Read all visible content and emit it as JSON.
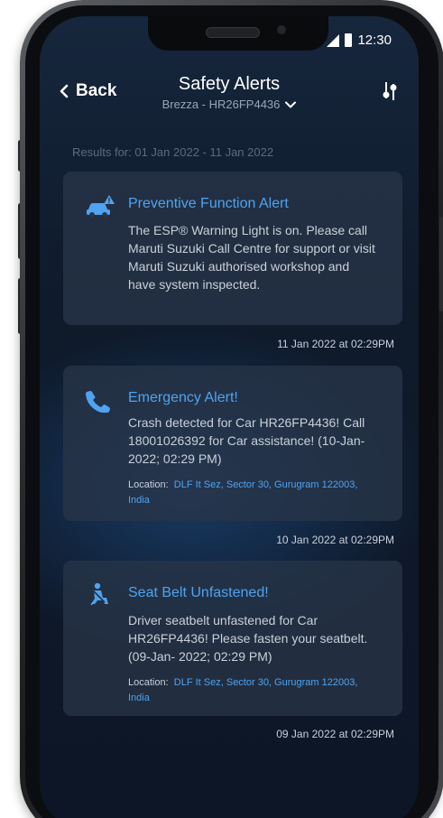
{
  "status_bar": {
    "time": "12:30"
  },
  "header": {
    "back_label": "Back",
    "title": "Safety Alerts",
    "subtitle": "Brezza - HR26FP4436"
  },
  "results_text": "Results for: 01 Jan 2022 - 11 Jan 2022",
  "alerts": [
    {
      "icon": "car-warning-icon",
      "title": "Preventive Function Alert",
      "body": "The ESP® Warning Light is on. Please call Maruti Suzuki Call Centre for support or visit Maruti Suzuki authorised workshop and have system inspected.",
      "timestamp": "11 Jan 2022 at 02:29PM"
    },
    {
      "icon": "phone-icon",
      "title": "Emergency Alert!",
      "body": "Crash detected for Car HR26FP4436! Call 18001026392 for Car assistance! (10-Jan-2022; 02:29 PM)",
      "location_label": "Location:",
      "location_value": "DLF It Sez, Sector 30, Gurugram 122003, India",
      "timestamp": "10 Jan 2022 at 02:29PM"
    },
    {
      "icon": "seatbelt-icon",
      "title": "Seat Belt Unfastened!",
      "body": "Driver seatbelt unfastened for Car HR26FP4436! Please fasten your seatbelt. (09-Jan- 2022; 02:29 PM)",
      "location_label": "Location:",
      "location_value": "DLF It Sez, Sector 30, Gurugram 122003, India",
      "timestamp": "09 Jan 2022 at 02:29PM"
    }
  ],
  "colors": {
    "accent": "#4fa3f0",
    "card": "#283448",
    "background": "#0f1a2b"
  }
}
